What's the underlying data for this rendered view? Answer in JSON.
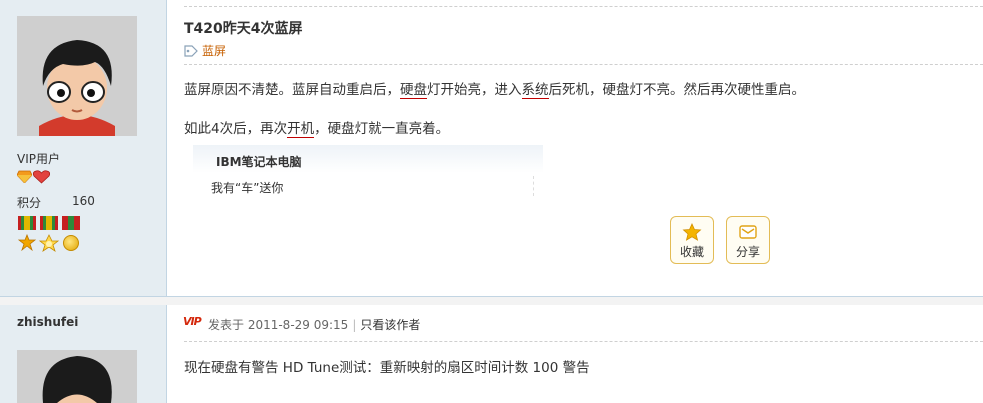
{
  "post1": {
    "user_group": "VIP用户",
    "points_label": "积分",
    "points_value": "160",
    "title": "T420昨天4次蓝屏",
    "tag": "蓝屏",
    "content": {
      "line1_parts": [
        "蓝屏原因不清楚。蓝屏自动重启后，",
        "硬盘",
        "灯开始亮，进入",
        "系统",
        "后死机，硬盘灯不亮。然后再次硬性重启。"
      ],
      "line2_parts": [
        "如此4次后，再次",
        "开机",
        "，硬盘灯就一直亮着。"
      ]
    },
    "signature": {
      "title": "IBM笔记本电脑",
      "text": "我有“车”送你"
    },
    "actions": {
      "favorite_label": "收藏",
      "share_label": "分享"
    },
    "icons": [
      "tag-icon",
      "gem-icon",
      "heart-gem-icon",
      "medal-icon",
      "star-icon",
      "envelope-icon"
    ]
  },
  "post2": {
    "author": "zhishufei",
    "vip_badge": "VIP",
    "posted_at": "发表于 2011-8-29 09:15",
    "separator": "|",
    "only_author_link": "只看该作者",
    "content": "现在硬盘有警告 HD Tune测试：重新映射的扇区时间计数 100  警告"
  },
  "colors": {
    "sidebar_bg": "#e5edf2",
    "border": "#c2d5e3",
    "tag_link": "#c65f00",
    "button_border": "#e3bc56",
    "underline": "#c00000"
  }
}
